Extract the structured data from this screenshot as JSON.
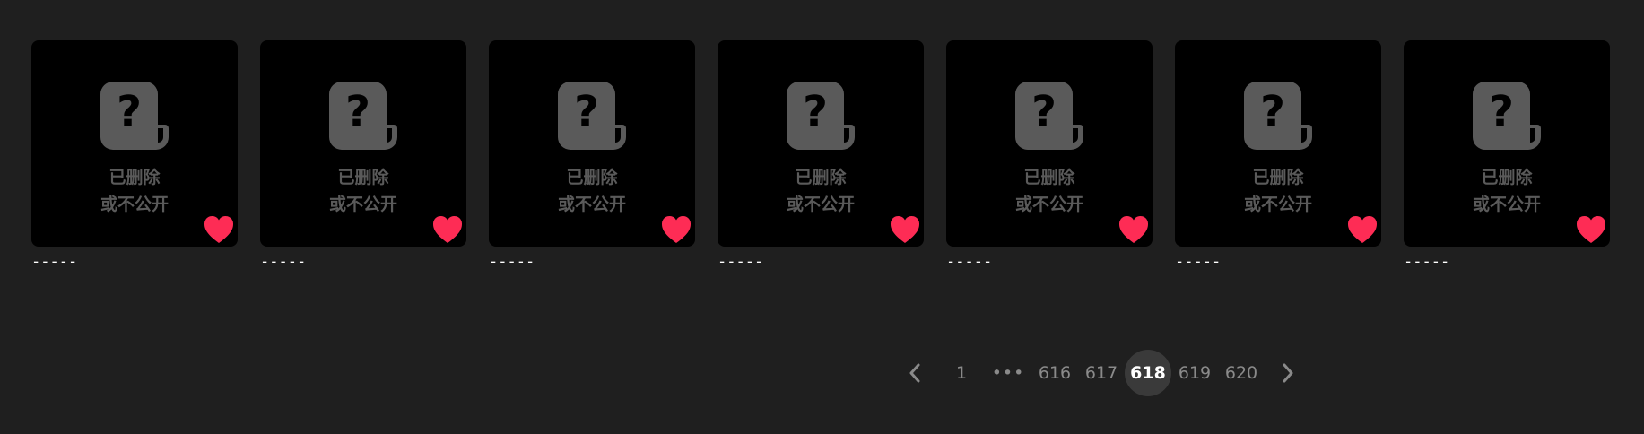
{
  "colors": {
    "background": "#1f1f1f",
    "card": "#000000",
    "placeholder_icon": "#5a5a5a",
    "heart": "#fe2c55",
    "active_page_bg": "#3a3a3a"
  },
  "cards": [
    {
      "status_line1": "已删除",
      "status_line2": "或不公开",
      "title": "-----",
      "icon": "unknown-document-icon",
      "liked": true
    },
    {
      "status_line1": "已删除",
      "status_line2": "或不公开",
      "title": "-----",
      "icon": "unknown-document-icon",
      "liked": true
    },
    {
      "status_line1": "已删除",
      "status_line2": "或不公开",
      "title": "-----",
      "icon": "unknown-document-icon",
      "liked": true
    },
    {
      "status_line1": "已删除",
      "status_line2": "或不公开",
      "title": "-----",
      "icon": "unknown-document-icon",
      "liked": true
    },
    {
      "status_line1": "已删除",
      "status_line2": "或不公开",
      "title": "-----",
      "icon": "unknown-document-icon",
      "liked": true
    },
    {
      "status_line1": "已删除",
      "status_line2": "或不公开",
      "title": "-----",
      "icon": "unknown-document-icon",
      "liked": true
    },
    {
      "status_line1": "已删除",
      "status_line2": "或不公开",
      "title": "-----",
      "icon": "unknown-document-icon",
      "liked": true
    }
  ],
  "pagination": {
    "prev_icon": "chevron-left-icon",
    "next_icon": "chevron-right-icon",
    "first": "1",
    "ellipsis": "•••",
    "pages": [
      "616",
      "617",
      "618",
      "619",
      "620"
    ],
    "current": "618"
  }
}
